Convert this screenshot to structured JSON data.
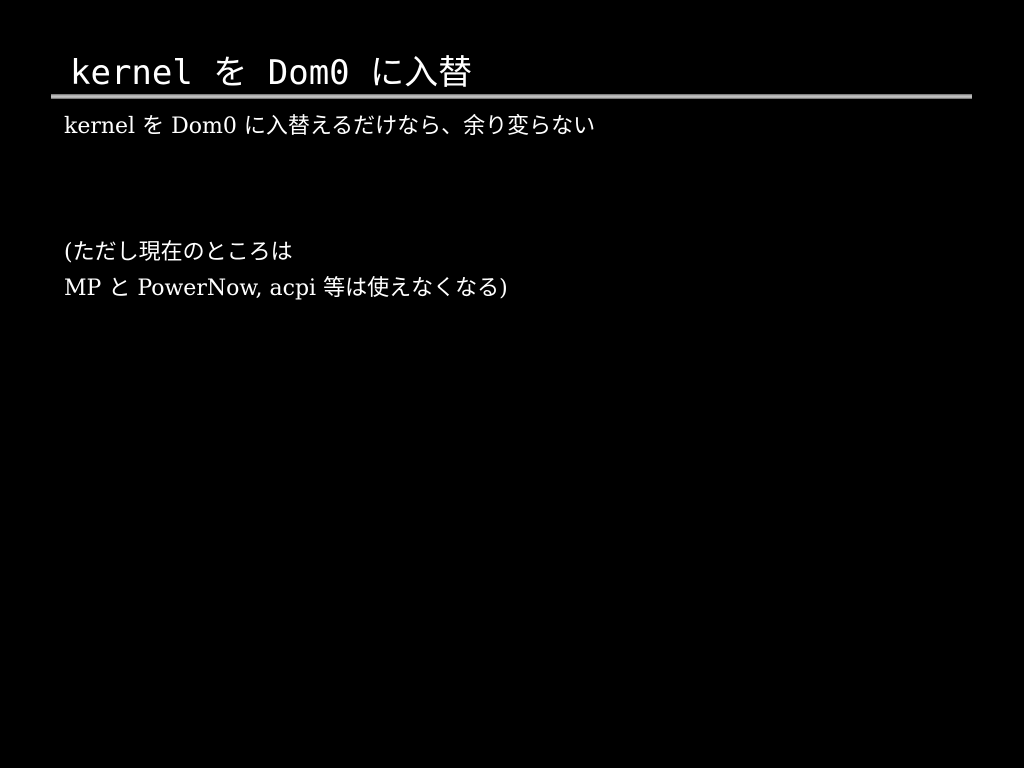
{
  "slide": {
    "title": "kernel を Dom0 に入替",
    "lines": [
      "kernel を Dom0 に入替えるだけなら、余り変らない",
      "(ただし現在のところは",
      " MP と PowerNow, acpi 等は使えなくなる)"
    ]
  },
  "colors": {
    "background": "#000000",
    "text": "#ffffff",
    "rule": "#c4c4c4"
  }
}
